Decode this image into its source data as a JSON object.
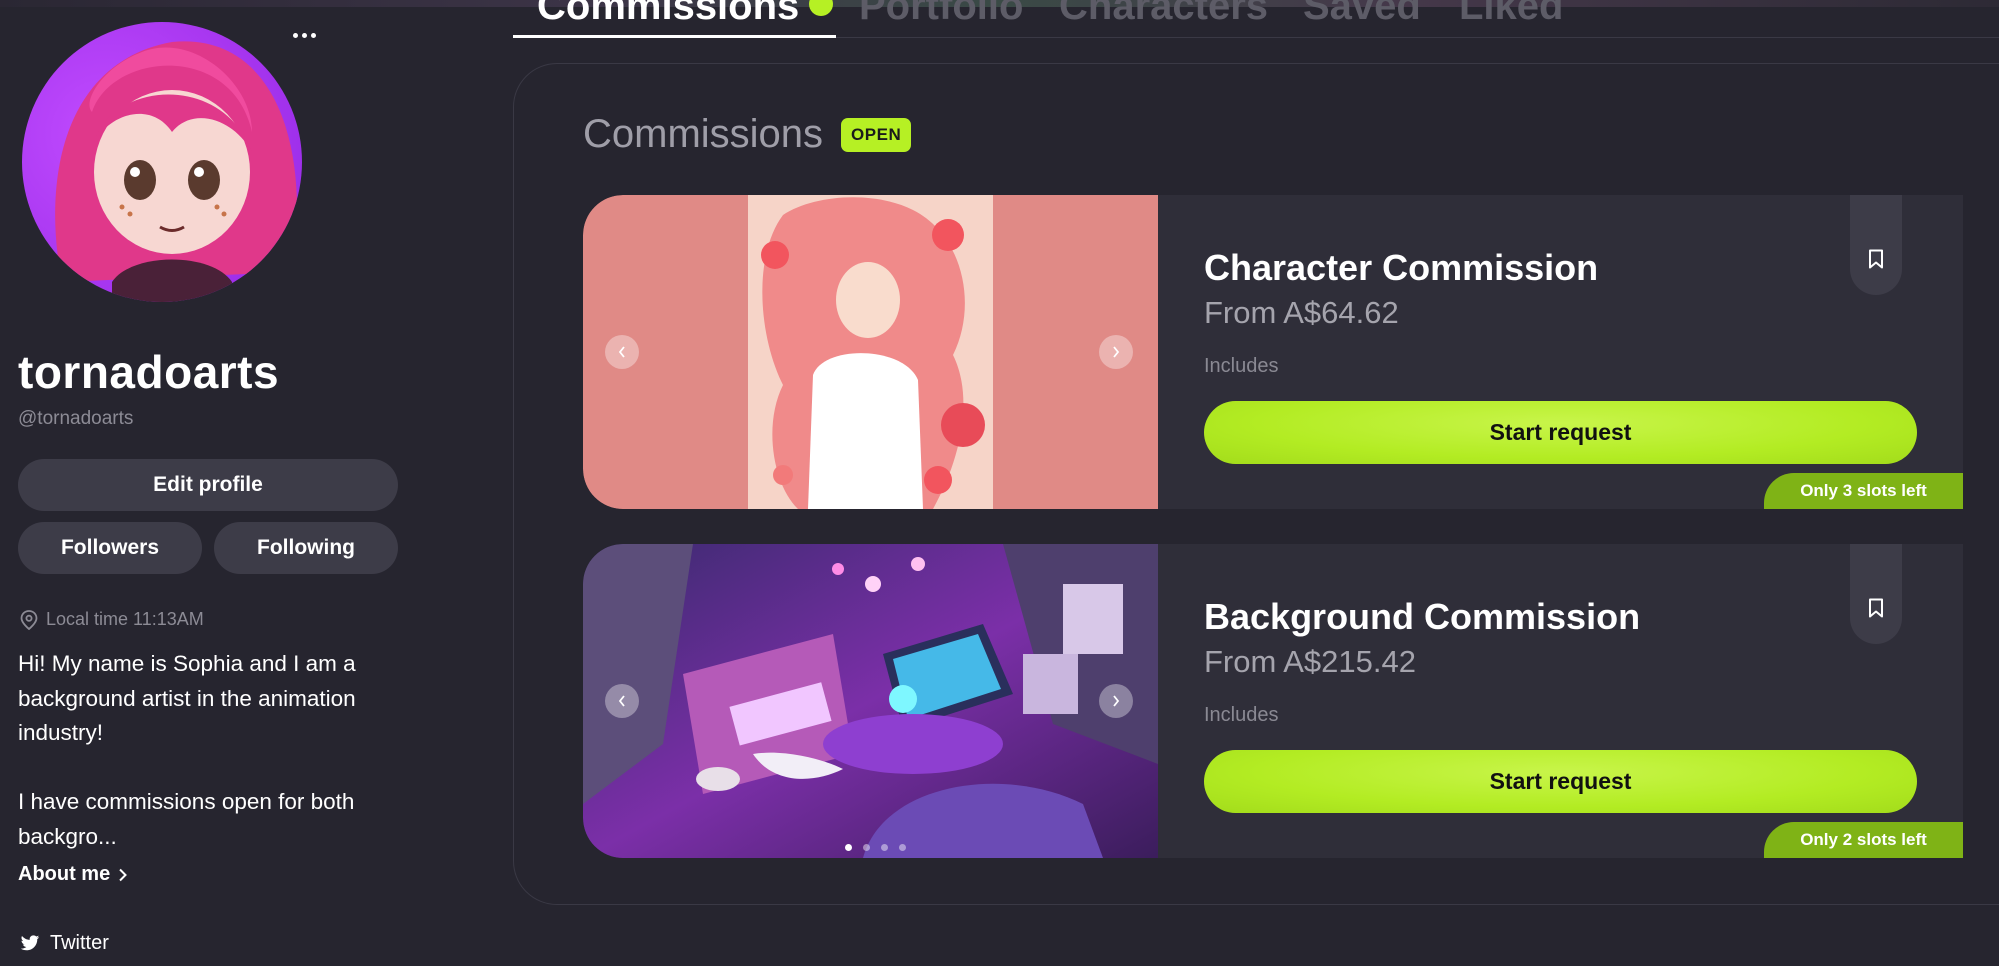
{
  "profile": {
    "username": "tornadoarts",
    "handle": "@tornadoarts",
    "edit_label": "Edit profile",
    "followers_label": "Followers",
    "following_label": "Following",
    "local_time": "Local time 11:13AM",
    "bio_line1": "Hi! My name is Sophia and I am a background artist in the animation industry!",
    "bio_line2": "I have commissions open for both backgro...",
    "about_label": "About me",
    "twitter_label": "Twitter"
  },
  "tabs": [
    {
      "label": "Commissions",
      "active": true
    },
    {
      "label": "Portfolio",
      "active": false
    },
    {
      "label": "Characters",
      "active": false
    },
    {
      "label": "Saved",
      "active": false
    },
    {
      "label": "Liked",
      "active": false
    }
  ],
  "commissions": {
    "title": "Commissions",
    "status": "OPEN",
    "cards": [
      {
        "title": "Character Commission",
        "price": "From A$64.62",
        "includes": "Includes",
        "button": "Start request",
        "slots": "Only 3 slots left"
      },
      {
        "title": "Background Commission",
        "price": "From A$215.42",
        "includes": "Includes",
        "button": "Start request",
        "slots": "Only 2 slots left"
      }
    ]
  },
  "colors": {
    "background": "#26252f",
    "card": "#2f2e39",
    "accent": "#b6f024",
    "slots_badge": "#7fb316"
  }
}
